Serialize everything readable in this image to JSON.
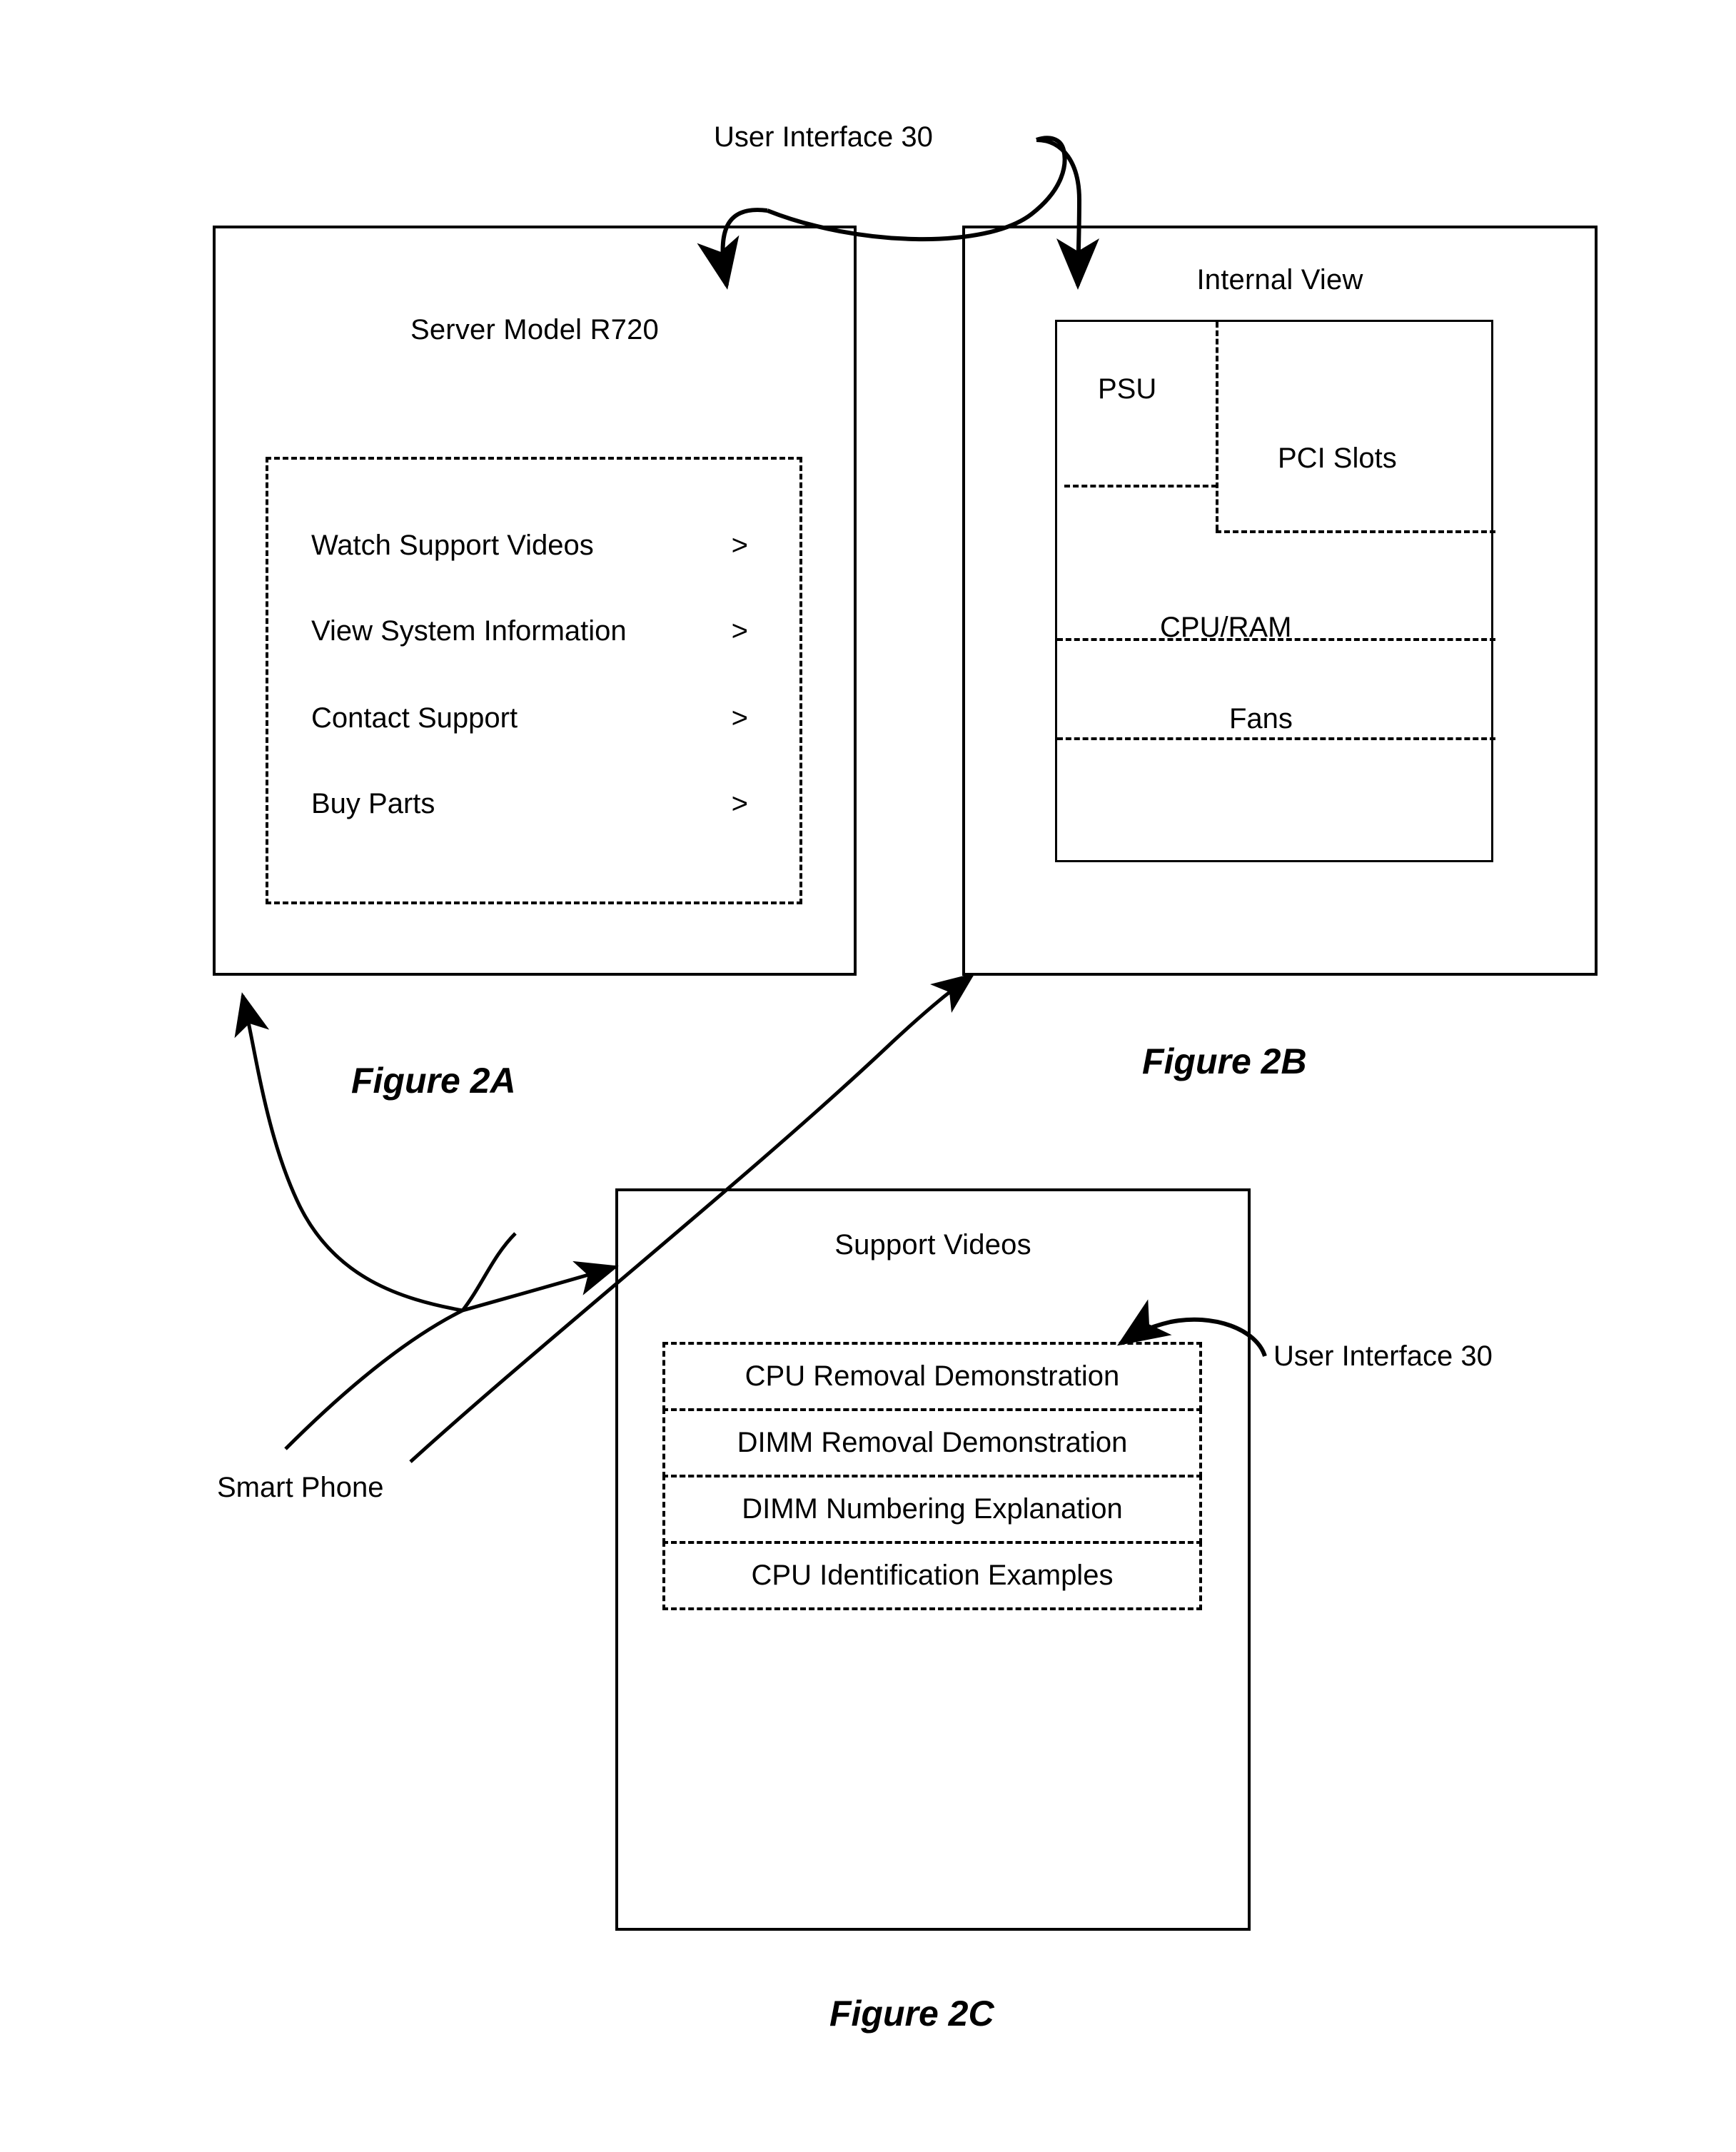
{
  "figures": [
    {
      "id": "2A",
      "caption": "Figure 2A",
      "screen_title": "Server Model R720",
      "menu_items": [
        {
          "label": "Watch Support Videos",
          "chevron": ">"
        },
        {
          "label": "View System Information",
          "chevron": ">"
        },
        {
          "label": "Contact Support",
          "chevron": ">"
        },
        {
          "label": "Buy Parts",
          "chevron": ">"
        }
      ]
    },
    {
      "id": "2B",
      "caption": "Figure 2B",
      "screen_title": "Internal View",
      "regions": [
        {
          "name": "psu",
          "label": "PSU"
        },
        {
          "name": "pci-slots",
          "label": "PCI Slots"
        },
        {
          "name": "cpu-ram",
          "label": "CPU/RAM"
        },
        {
          "name": "fans",
          "label": "Fans"
        }
      ]
    },
    {
      "id": "2C",
      "caption": "Figure 2C",
      "screen_title": "Support Videos",
      "video_items": [
        {
          "label": "CPU Removal Demonstration"
        },
        {
          "label": "DIMM Removal Demonstration"
        },
        {
          "label": "DIMM Numbering Explanation"
        },
        {
          "label": "CPU Identification Examples"
        }
      ]
    }
  ],
  "callouts": {
    "user_interface_top": "User Interface 30",
    "user_interface_right": "User Interface 30",
    "smart_phone": "Smart Phone"
  },
  "colors": {
    "ink": "#000000",
    "background": "#ffffff"
  }
}
